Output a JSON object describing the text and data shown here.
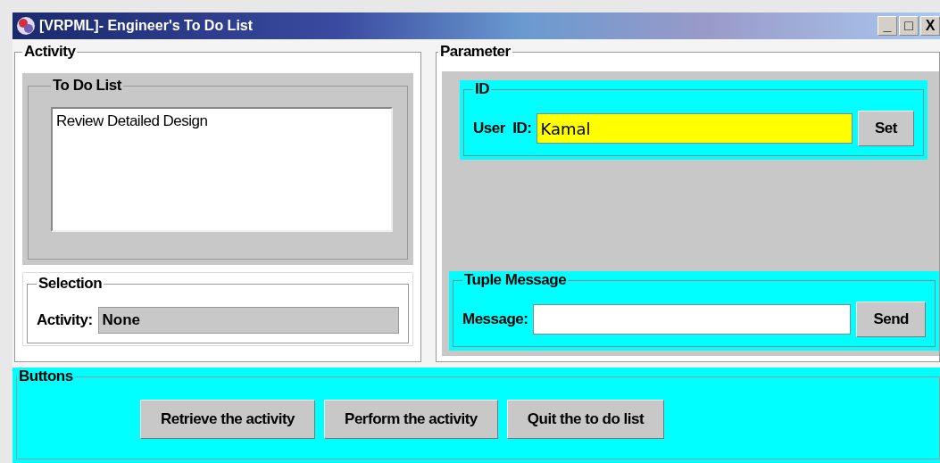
{
  "window": {
    "title": "[VRPML]- Engineer's To Do List",
    "controls": [
      "_",
      "□",
      "X"
    ]
  },
  "activity": {
    "title": "Activity",
    "todo": {
      "title": "To Do List",
      "items": [
        "Review Detailed Design"
      ]
    },
    "selection": {
      "title": "Selection",
      "label": "Activity:",
      "value": "None"
    }
  },
  "parameter": {
    "title": "Parameter",
    "id": {
      "title": "ID",
      "label": "User  ID:",
      "value": "Kamal",
      "button": "Set"
    },
    "tuple": {
      "title": "Tuple Message",
      "label": "Message:",
      "button": "Send"
    }
  },
  "buttons": {
    "title": "Buttons",
    "items": [
      "Retrieve the activity",
      "Perform the activity",
      "Quit the to do list"
    ]
  }
}
